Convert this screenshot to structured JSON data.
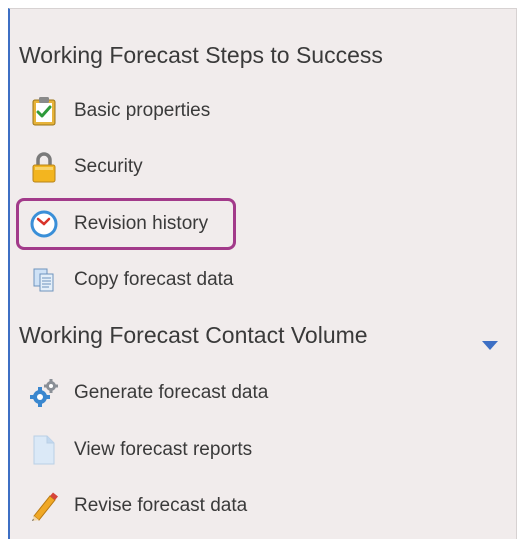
{
  "panel": {
    "accent_color": "#3d6fc4",
    "highlight_color": "#a23a8a",
    "sections": [
      {
        "title": "Working Forecast Steps to Success",
        "items": [
          {
            "label": "Basic properties",
            "icon": "clipboard-check-icon"
          },
          {
            "label": "Security",
            "icon": "padlock-icon"
          },
          {
            "label": "Revision history",
            "icon": "clock-icon",
            "highlighted": true
          },
          {
            "label": "Copy forecast data",
            "icon": "copy-documents-icon"
          }
        ]
      },
      {
        "title": "Working Forecast Contact Volume",
        "collapse_icon": "triangle-down-icon",
        "items": [
          {
            "label": "Generate forecast data",
            "icon": "gears-icon"
          },
          {
            "label": "View forecast reports",
            "icon": "document-icon"
          },
          {
            "label": "Revise forecast data",
            "icon": "pencil-icon"
          }
        ]
      }
    ]
  }
}
